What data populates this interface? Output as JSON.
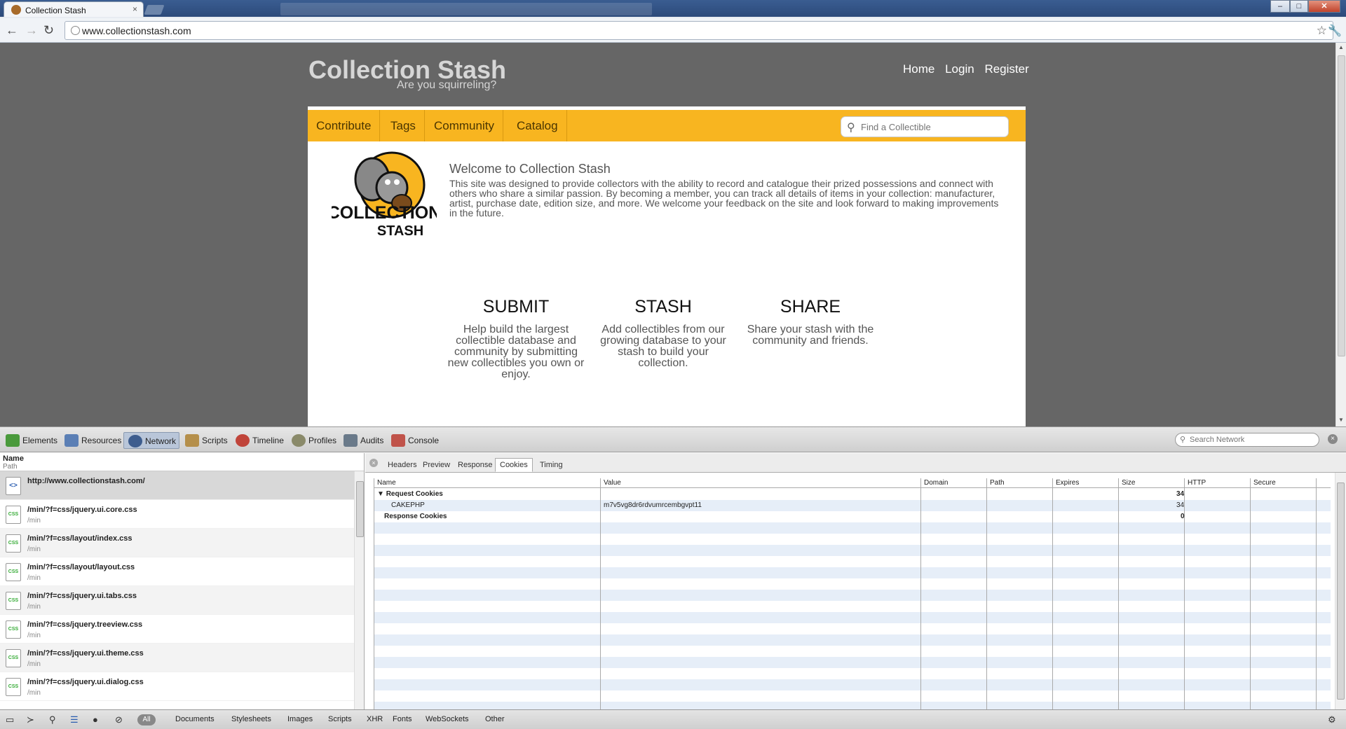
{
  "browser": {
    "tab_title": "Collection Stash",
    "tab_close": "×",
    "url": "www.collectionstash.com",
    "win_min": "–",
    "win_max": "□",
    "win_close": "✕"
  },
  "site": {
    "title": "Collection Stash",
    "tagline": "Are you squirreling?",
    "topnav": [
      "Home",
      "Login",
      "Register"
    ],
    "nav_tabs": [
      "Contribute",
      "Tags",
      "Community",
      "Catalog"
    ],
    "search_placeholder": "Find a Collectible",
    "welcome_title": "Welcome to Collection Stash",
    "welcome_body": "This site was designed to provide collectors with the ability to record and catalogue their prized possessions and connect with others who share a similar passion. By becoming a member, you can track all details of items in your collection: manufacturer, artist, purchase date, edition size, and more. We welcome your feedback on the site and look forward to making improvements in the future.",
    "logo_line1": "COLLECTION",
    "logo_line2": "STASH",
    "features": [
      {
        "heading": "SUBMIT",
        "text": "Help build the largest collectible database and community by submitting new collectibles you own or enjoy."
      },
      {
        "heading": "STASH",
        "text": "Add collectibles from our growing database to your stash to build your collection."
      },
      {
        "heading": "SHARE",
        "text": "Share your stash with the community and friends."
      }
    ]
  },
  "devtools": {
    "panels": [
      "Elements",
      "Resources",
      "Network",
      "Scripts",
      "Timeline",
      "Profiles",
      "Audits",
      "Console"
    ],
    "active_panel": "Network",
    "search_placeholder": "Search Network",
    "list_header_name": "Name",
    "list_header_path": "Path",
    "files": [
      {
        "name": "http://www.collectionstash.com/",
        "path": "",
        "type": "html"
      },
      {
        "name": "/min/?f=css/jquery.ui.core.css",
        "path": "/min",
        "type": "css"
      },
      {
        "name": "/min/?f=css/layout/index.css",
        "path": "/min",
        "type": "css"
      },
      {
        "name": "/min/?f=css/layout/layout.css",
        "path": "/min",
        "type": "css"
      },
      {
        "name": "/min/?f=css/jquery.ui.tabs.css",
        "path": "/min",
        "type": "css"
      },
      {
        "name": "/min/?f=css/jquery.treeview.css",
        "path": "/min",
        "type": "css"
      },
      {
        "name": "/min/?f=css/jquery.ui.theme.css",
        "path": "/min",
        "type": "css"
      },
      {
        "name": "/min/?f=css/jquery.ui.dialog.css",
        "path": "/min",
        "type": "css"
      }
    ],
    "file_icon_css": "CSS",
    "file_icon_html": "<>",
    "detail_tabs": [
      "Headers",
      "Preview",
      "Response",
      "Cookies",
      "Timing"
    ],
    "active_detail_tab": "Cookies",
    "cookie_columns": [
      "Name",
      "Value",
      "Domain",
      "Path",
      "Expires",
      "Size",
      "HTTP",
      "Secure"
    ],
    "request_cookies_label": "Request Cookies",
    "request_cookies_size": "34",
    "cookie_name": "CAKEPHP",
    "cookie_value": "m7v5vg8dr6rdvumrcembgvpt11",
    "cookie_size": "34",
    "response_cookies_label": "Response Cookies",
    "response_cookies_size": "0",
    "filters": [
      "All",
      "Documents",
      "Stylesheets",
      "Images",
      "Scripts",
      "XHR",
      "Fonts",
      "WebSockets",
      "Other"
    ]
  },
  "colors": {
    "page_bg": "#666666",
    "nav_orange": "#f8b520",
    "title_gray": "#d6d6d6"
  }
}
